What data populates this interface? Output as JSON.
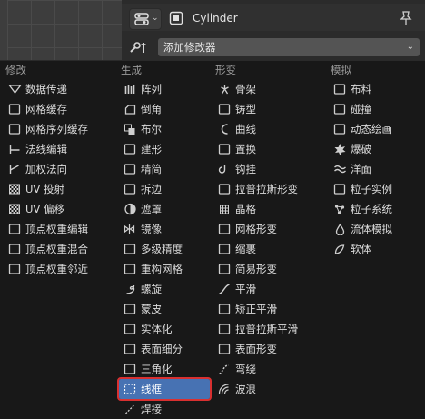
{
  "header": {
    "object_name": "Cylinder",
    "add_modifier_label": "添加修改器"
  },
  "menu": {
    "columns": [
      {
        "heading": "修改",
        "items": [
          {
            "label": "数据传递",
            "icon": "data-transfer-icon"
          },
          {
            "label": "网格缓存",
            "icon": "mesh-cache-icon"
          },
          {
            "label": "网格序列缓存",
            "icon": "mesh-sequence-cache-icon"
          },
          {
            "label": "法线编辑",
            "icon": "normal-edit-icon"
          },
          {
            "label": "加权法向",
            "icon": "weighted-normal-icon"
          },
          {
            "label": "UV 投射",
            "icon": "uv-project-icon"
          },
          {
            "label": "UV 偏移",
            "icon": "uv-warp-icon"
          },
          {
            "label": "顶点权重编辑",
            "icon": "vertex-weight-edit-icon"
          },
          {
            "label": "顶点权重混合",
            "icon": "vertex-weight-mix-icon"
          },
          {
            "label": "顶点权重邻近",
            "icon": "vertex-weight-proximity-icon"
          }
        ]
      },
      {
        "heading": "生成",
        "items": [
          {
            "label": "阵列",
            "icon": "array-icon"
          },
          {
            "label": "倒角",
            "icon": "bevel-icon"
          },
          {
            "label": "布尔",
            "icon": "boolean-icon"
          },
          {
            "label": "建形",
            "icon": "build-icon"
          },
          {
            "label": "精简",
            "icon": "decimate-icon"
          },
          {
            "label": "拆边",
            "icon": "edge-split-icon"
          },
          {
            "label": "遮罩",
            "icon": "mask-icon"
          },
          {
            "label": "镜像",
            "icon": "mirror-icon"
          },
          {
            "label": "多级精度",
            "icon": "multires-icon"
          },
          {
            "label": "重构网格",
            "icon": "remesh-icon"
          },
          {
            "label": "螺旋",
            "icon": "screw-icon"
          },
          {
            "label": "蒙皮",
            "icon": "skin-icon"
          },
          {
            "label": "实体化",
            "icon": "solidify-icon"
          },
          {
            "label": "表面细分",
            "icon": "subdivision-icon"
          },
          {
            "label": "三角化",
            "icon": "triangulate-icon"
          },
          {
            "label": "线框",
            "icon": "wireframe-icon",
            "highlighted": true
          },
          {
            "label": "焊接",
            "icon": "weld-icon"
          }
        ]
      },
      {
        "heading": "形变",
        "items": [
          {
            "label": "骨架",
            "icon": "armature-icon"
          },
          {
            "label": "铸型",
            "icon": "cast-icon"
          },
          {
            "label": "曲线",
            "icon": "curve-icon"
          },
          {
            "label": "置换",
            "icon": "displace-icon"
          },
          {
            "label": "钩挂",
            "icon": "hook-icon"
          },
          {
            "label": "拉普拉斯形变",
            "icon": "laplacian-deform-icon"
          },
          {
            "label": "晶格",
            "icon": "lattice-icon"
          },
          {
            "label": "网格形变",
            "icon": "mesh-deform-icon"
          },
          {
            "label": "缩裹",
            "icon": "shrinkwrap-icon"
          },
          {
            "label": "简易形变",
            "icon": "simple-deform-icon"
          },
          {
            "label": "平滑",
            "icon": "smooth-icon"
          },
          {
            "label": "矫正平滑",
            "icon": "corrective-smooth-icon"
          },
          {
            "label": "拉普拉斯平滑",
            "icon": "laplacian-smooth-icon"
          },
          {
            "label": "表面形变",
            "icon": "surface-deform-icon"
          },
          {
            "label": "弯绕",
            "icon": "warp-icon"
          },
          {
            "label": "波浪",
            "icon": "wave-icon"
          }
        ]
      },
      {
        "heading": "模拟",
        "items": [
          {
            "label": "布料",
            "icon": "cloth-icon"
          },
          {
            "label": "碰撞",
            "icon": "collision-icon"
          },
          {
            "label": "动态绘画",
            "icon": "dynamic-paint-icon"
          },
          {
            "label": "爆破",
            "icon": "explode-icon"
          },
          {
            "label": "洋面",
            "icon": "ocean-icon"
          },
          {
            "label": "粒子实例",
            "icon": "particle-instance-icon"
          },
          {
            "label": "粒子系统",
            "icon": "particle-system-icon"
          },
          {
            "label": "流体模拟",
            "icon": "fluid-icon"
          },
          {
            "label": "软体",
            "icon": "soft-body-icon"
          }
        ]
      }
    ]
  }
}
